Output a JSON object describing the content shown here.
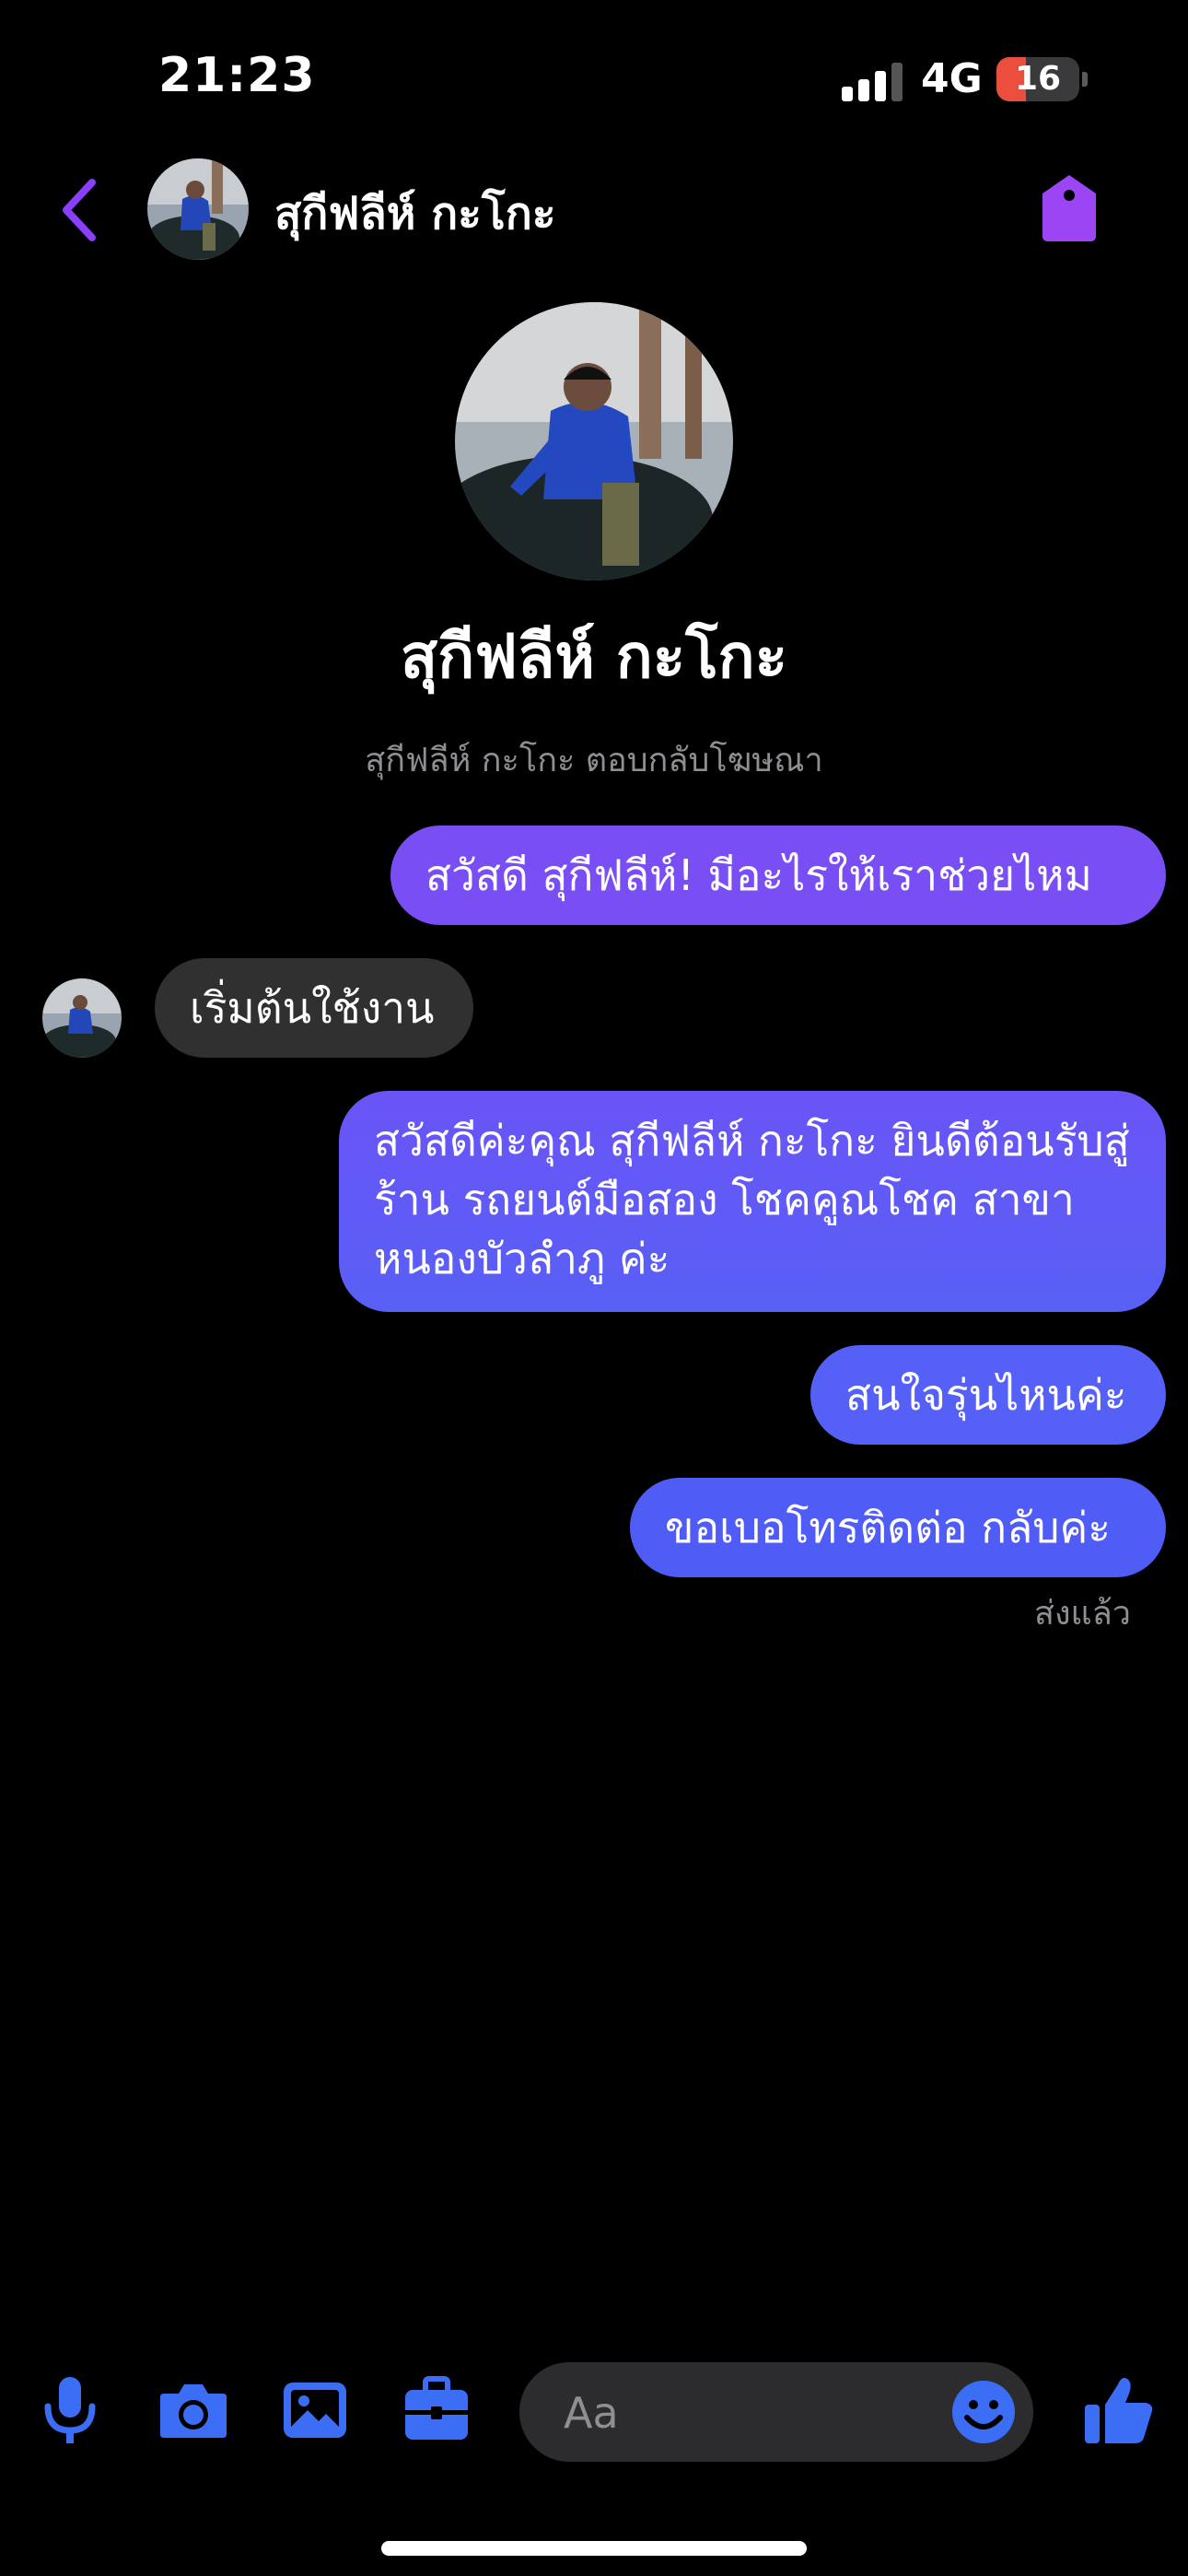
{
  "status_bar": {
    "time": "21:23",
    "network": "4G",
    "battery_level": "16",
    "battery_fraction": 0.16
  },
  "header": {
    "contact_name": "สุกีฟลีห์ กะโกะ"
  },
  "profile": {
    "name": "สุกีฟลีห์ กะโกะ",
    "subtitle": "สุกีฟลีห์ กะโกะ ตอบกลับโฆษณา"
  },
  "messages": [
    {
      "direction": "outgoing",
      "text": "สวัสดี สุกีฟลีห์! มีอะไรให้เราช่วยไหม"
    },
    {
      "direction": "incoming",
      "text": "เริ่มต้นใช้งาน"
    },
    {
      "direction": "outgoing",
      "text": "สวัสดีค่ะคุณ สุกีฟลีห์ กะโกะ ยินดีต้อนรับสู่ร้าน รถยนต์มือสอง โชคคูณโชค สาขาหนองบัวลำภู ค่ะ"
    },
    {
      "direction": "outgoing",
      "text": "สนใจรุ่นไหนค่ะ"
    },
    {
      "direction": "outgoing",
      "text": "ขอเบอโทรติดต่อ กลับค่ะ"
    }
  ],
  "sent_status": "ส่งแล้ว",
  "composer": {
    "placeholder": "Aa",
    "icons": [
      "microphone-icon",
      "camera-icon",
      "photo-icon",
      "briefcase-icon",
      "emoji-icon",
      "thumbs-up-icon"
    ]
  },
  "colors": {
    "accent": "#8a3ffc",
    "bubble_gradient_start": "#8a4bf5",
    "bubble_gradient_end": "#4f5cf6",
    "icon_blue": "#3b6ef5",
    "incoming_bubble": "#303030"
  }
}
